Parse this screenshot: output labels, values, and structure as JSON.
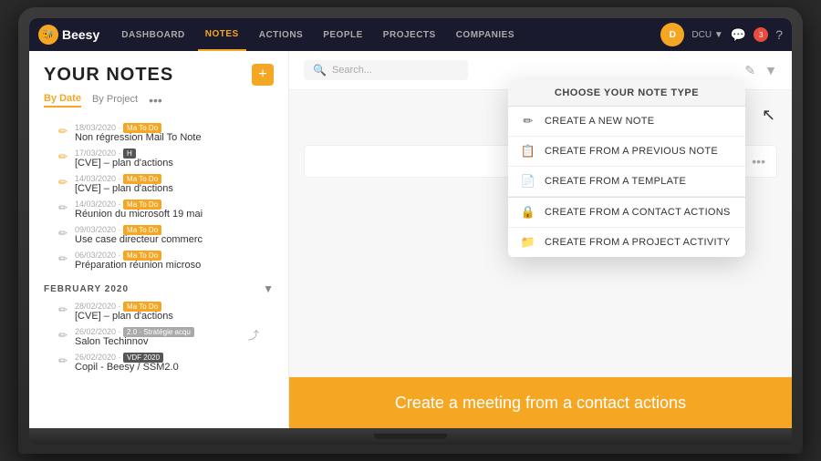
{
  "app": {
    "name": "Beesy"
  },
  "navbar": {
    "logo": "🐝",
    "items": [
      {
        "label": "DASHBOARD",
        "active": false
      },
      {
        "label": "NOTES",
        "active": true
      },
      {
        "label": "ACTIONS",
        "active": false
      },
      {
        "label": "PEOPLE",
        "active": false
      },
      {
        "label": "PROJECTS",
        "active": false
      },
      {
        "label": "COMPANIES",
        "active": false
      }
    ],
    "username": "DCU ▼",
    "chat_icon": "💬",
    "notif_count": "3"
  },
  "left_panel": {
    "title": "YOUR NOTES",
    "tab_by_date": "By Date",
    "tab_by_project": "By Project",
    "sections": [
      {
        "month": "",
        "notes": [
          {
            "date": "18/03/2020",
            "tag": "Ma To Do",
            "title": "Non régression Mail To Note",
            "pinned": true
          },
          {
            "date": "17/03/2020",
            "tag": "H",
            "title": "[CVE] – plan d'actions",
            "pinned": true
          },
          {
            "date": "14/03/2020",
            "tag": "Ma To Do",
            "title": "[CVE] – plan d'actions",
            "pinned": true
          },
          {
            "date": "14/03/2020",
            "tag": "Ma To Do",
            "title": "Réunion du microsoft 19 mai",
            "pinned": false
          },
          {
            "date": "09/03/2020",
            "tag": "Ma To Do",
            "title": "Use case directeur commerc",
            "pinned": false
          },
          {
            "date": "06/03/2020",
            "tag": "Ma To Do",
            "title": "Préparation réunion microso",
            "pinned": false
          }
        ]
      },
      {
        "month": "FEBRUARY 2020",
        "collapsed": false,
        "notes": [
          {
            "date": "28/02/2020",
            "tag": "Ma To Do",
            "title": "[CVE] – plan d'actions",
            "pinned": false
          },
          {
            "date": "26/02/2020",
            "tag": "2.0 · Stratégie acqu",
            "title": "Salon Techinnov",
            "pinned": false,
            "share": true
          },
          {
            "date": "26/02/2020",
            "tag": "VDF 2020",
            "title": "Copil - Beesy / SSM2.0",
            "pinned": false
          }
        ]
      }
    ]
  },
  "right_panel": {
    "search_placeholder": "Search...",
    "three_dots": "•••"
  },
  "dropdown": {
    "header": "CHOOSE YOUR NOTE TYPE",
    "items": [
      {
        "icon": "✏️",
        "label": "CREATE A NEW NOTE",
        "separator_after": false
      },
      {
        "icon": "📋",
        "label": "CREATE FROM A PREVIOUS NOTE",
        "separator_after": false
      },
      {
        "icon": "📄",
        "label": "CREATE FROM A TEMPLATE",
        "separator_after": true
      },
      {
        "icon": "🔒",
        "label": "CREATE FROM A CONTACT ACTIONS",
        "separator_after": false
      },
      {
        "icon": "📁",
        "label": "CREATE FROM A PROJECT ACTIVITY",
        "separator_after": false
      }
    ]
  },
  "bottom_banner": {
    "text": "Create a meeting from a contact actions"
  }
}
